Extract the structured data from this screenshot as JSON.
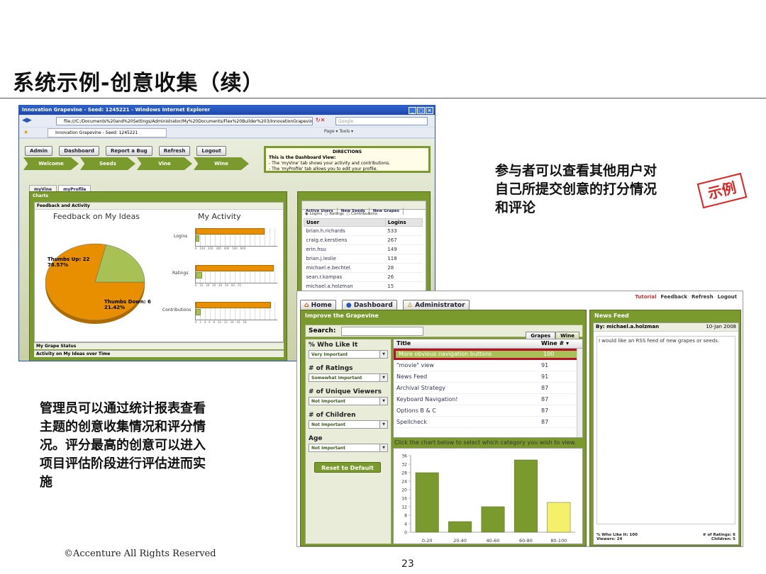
{
  "slide": {
    "title": "系统示例-创意收集（续）",
    "page_number": "23",
    "copyright": "©Accenture   All Rights Reserved",
    "stamp": "示例",
    "annotation_right": [
      "参与者可以查看其他用户对",
      "自己所提交创意的打分情况",
      "和评论"
    ],
    "annotation_left": [
      "管理员可以通过统计报表查看",
      "主题的创意收集情况和评分情",
      "况。评分最高的创意可以进入",
      "项目评估阶段进行评估进而实",
      "施"
    ]
  },
  "ie": {
    "window_title": "Innovation Grapevine - Seed: 1245221 - Windows Internet Explorer",
    "address": "file:///C:/Documents%20and%20Settings/Administrator/My%20Documents/Flex%20Builder%203/InnovationGrapevine2/bin",
    "search_placeholder": "Google",
    "tab_label": "Innovation Grapevine - Seed: 1245221",
    "tools": "Page ▾   Tools ▾",
    "toolbar": {
      "admin": "Admin",
      "dashboard": "Dashboard",
      "report": "Report a Bug",
      "refresh": "Refresh",
      "logout": "Logout"
    },
    "steps": [
      "Welcome",
      "Seeds",
      "Vine",
      "Wine"
    ],
    "directions": {
      "title": "DIRECTIONS",
      "l1": "This is the Dashboard View:",
      "l2": "- The 'myVine' tab shows your activity and contributions.",
      "l3": "- The 'myProfile' tab allows you to edit your profile."
    },
    "subtabs": [
      "myVine",
      "myProfile"
    ],
    "charts_header": "Charts",
    "feedback_header": "Feedback and Activity",
    "feedback_title": "Feedback on My Ideas",
    "activity_title": "My Activity",
    "activity_rows": [
      "Logins",
      "Ratings",
      "Contributions"
    ],
    "grape_status": "My Grape Status",
    "grape_activity": "Activity on My Ideas over Time",
    "users_tabs": [
      "Active Users",
      "New Seeds",
      "New Grapes"
    ],
    "users_radio": [
      "Logins",
      "Ratings",
      "Contributions"
    ],
    "users_cols": [
      "User",
      "Logins"
    ],
    "users": [
      {
        "name": "brian.h.richards",
        "val": "533"
      },
      {
        "name": "craig.e.kerstiens",
        "val": "267"
      },
      {
        "name": "erin.hsu",
        "val": "149"
      },
      {
        "name": "brian.j.leslie",
        "val": "118"
      },
      {
        "name": "michael.e.bechtel",
        "val": "28"
      },
      {
        "name": "sean.r.kampas",
        "val": "26"
      },
      {
        "name": "michael.a.holzman",
        "val": "15"
      }
    ],
    "pie": {
      "slices": [
        {
          "label": "Thumbs Up: 22",
          "pct_label": "78.57%",
          "value": 78.57,
          "color": "#e88f00"
        },
        {
          "label": "Thumbs Down: 6",
          "pct_label": "21.42%",
          "value": 21.42,
          "color": "#a7c155"
        }
      ]
    }
  },
  "admin": {
    "top_links": [
      "Tutorial",
      "Feedback",
      "Refresh",
      "Logout"
    ],
    "nav": [
      "Home",
      "Dashboard",
      "Administrator"
    ],
    "panel_title": "Improve the Grapevine",
    "search_label": "Search:",
    "toggle": [
      "Grapes",
      "Wine"
    ],
    "filters": [
      {
        "label": "% Who Like It",
        "value": "Very Important"
      },
      {
        "label": "# of Ratings",
        "value": "Somewhat Important"
      },
      {
        "label": "# of Unique Viewers",
        "value": "Not Important"
      },
      {
        "label": "# of Children",
        "value": "Not Important"
      },
      {
        "label": "Age",
        "value": "Not Important"
      }
    ],
    "reset": "Reset to Default",
    "list_cols": [
      "Title",
      "Wine # ▾"
    ],
    "list_rows": [
      {
        "title": "More obvious navigation buttons",
        "wine": "100"
      },
      {
        "title": "\"movie\" view",
        "wine": "91"
      },
      {
        "title": "News Feed",
        "wine": "91"
      },
      {
        "title": "Archival Strategy",
        "wine": "87"
      },
      {
        "title": "Keyboard Navigation!",
        "wine": "87"
      },
      {
        "title": "Options B & C",
        "wine": "87"
      },
      {
        "title": "Spellcheck",
        "wine": "87"
      }
    ],
    "hint": "Click the chart below to select which category you wish to view.",
    "news_title": "News Feed",
    "news_by": "By:  michael.a.holzman",
    "news_date": "10-Jan 2008",
    "news_body": "I would like an RSS feed of new grapes or seeds.",
    "news_foot_l": "% Who Like It:   100",
    "news_foot_r": "# of Ratings:   6",
    "news_foot_l2": "Viewers:   24",
    "news_foot_r2": "Children:   5"
  },
  "chart_data": [
    {
      "type": "bar",
      "categories": [
        "0-20",
        "20-40",
        "40-60",
        "60-80",
        "80-100"
      ],
      "values": [
        28,
        5,
        12,
        34,
        14
      ],
      "ylim": [
        0,
        36
      ],
      "yticks": [
        0,
        4,
        8,
        12,
        16,
        20,
        24,
        28,
        32,
        36
      ],
      "colors": [
        "#7b9a2e",
        "#7b9a2e",
        "#7b9a2e",
        "#7b9a2e",
        "#f5f06a"
      ]
    },
    {
      "type": "pie",
      "categories": [
        "Thumbs Up: 22",
        "Thumbs Down: 6"
      ],
      "values": [
        78.57,
        21.42
      ]
    }
  ]
}
